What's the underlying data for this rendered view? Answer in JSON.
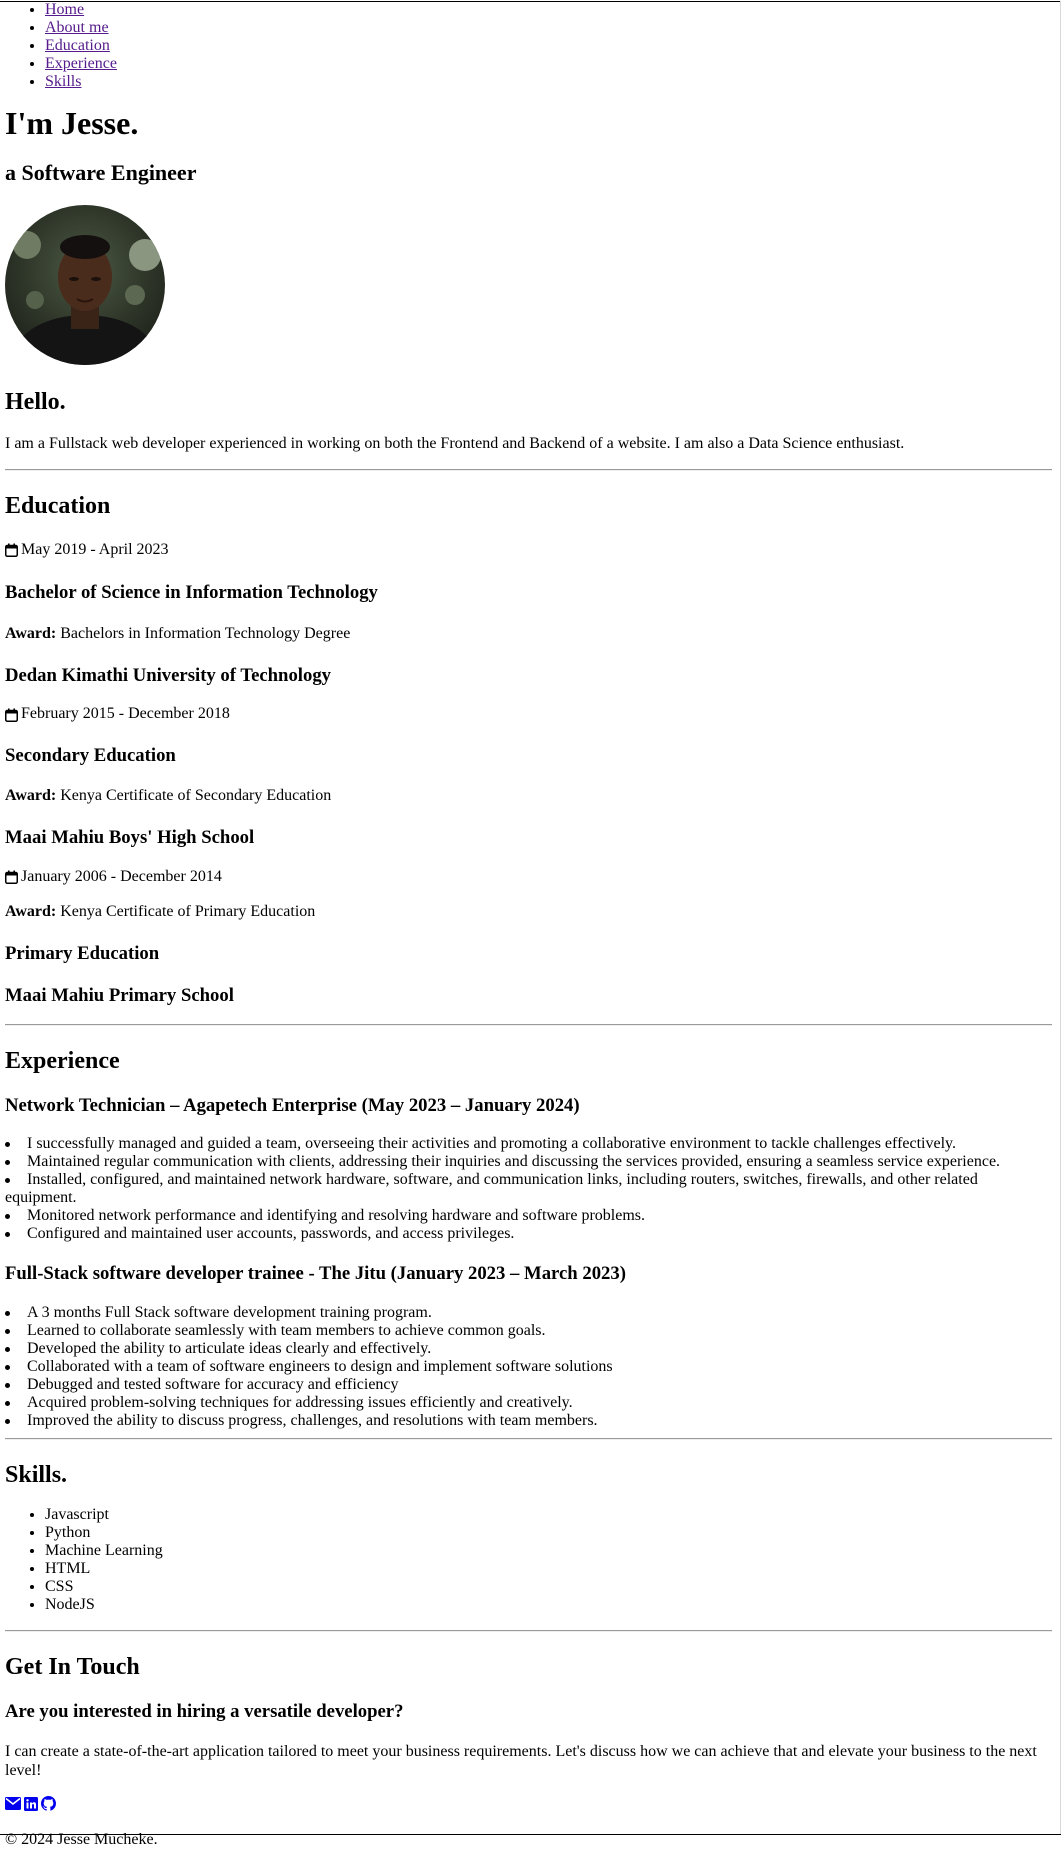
{
  "nav": {
    "items": [
      {
        "label": "Home"
      },
      {
        "label": "About me"
      },
      {
        "label": "Education"
      },
      {
        "label": "Experience"
      },
      {
        "label": "Skills"
      }
    ]
  },
  "hero": {
    "title": "I'm Jesse.",
    "subtitle": "a Software Engineer"
  },
  "about": {
    "heading": "Hello.",
    "text": "I am a Fullstack web developer experienced in working on both the Frontend and Backend of a website. I am also a Data Science enthusiast."
  },
  "education": {
    "heading": "Education",
    "award_label": "Award:",
    "date1": "May 2019 - April 2023",
    "degree1": "Bachelor of Science in Information Technology",
    "award1": "Bachelors in Information Technology Degree",
    "school1": "Dedan Kimathi University of Technology",
    "date2": "February 2015 - December 2018",
    "degree2": "Secondary Education",
    "award2": "Kenya Certificate of Secondary Education",
    "school2": "Maai Mahiu Boys' High School",
    "date3": "January 2006 - December 2014",
    "award3": "Kenya Certificate of Primary Education",
    "degree3": "Primary Education",
    "school3": "Maai Mahiu Primary School"
  },
  "experience": {
    "heading": "Experience",
    "job1": {
      "title": "Network Technician – Agapetech Enterprise (May 2023 – January 2024)",
      "bullets": [
        "I successfully managed and guided a team, overseeing their activities and promoting a collaborative environment to tackle challenges effectively.",
        "Maintained regular communication with clients, addressing their inquiries and discussing the services provided, ensuring a seamless service experience.",
        "Installed, configured, and maintained network hardware, software, and communication links, including routers, switches, firewalls, and other related equipment.",
        "Monitored network performance and identifying and resolving hardware and software problems.",
        "Configured and maintained user accounts, passwords, and access privileges."
      ]
    },
    "job2": {
      "title": "Full-Stack software developer trainee - The Jitu (January 2023 – March 2023)",
      "bullets": [
        "A 3 months Full Stack software development training program.",
        "Learned to collaborate seamlessly with team members to achieve common goals.",
        "Developed the ability to articulate ideas clearly and effectively.",
        "Collaborated with a team of software engineers to design and implement software solutions",
        "Debugged and tested software for accuracy and efficiency",
        "Acquired problem-solving techniques for addressing issues efficiently and creatively.",
        "Improved the ability to discuss progress, challenges, and resolutions with team members."
      ]
    }
  },
  "skills": {
    "heading": "Skills.",
    "items": [
      "Javascript",
      "Python",
      "Machine Learning",
      "HTML",
      "CSS",
      "NodeJS"
    ]
  },
  "contact": {
    "heading": "Get In Touch",
    "subheading": "Are you interested in hiring a versatile developer?",
    "text": "I can create a state-of-the-art application tailored to meet your business requirements. Let's discuss how we can achieve that and elevate your business to the next level!",
    "icons": [
      "envelope-icon",
      "linkedin-icon",
      "github-icon"
    ],
    "icon_color": "#0000ee"
  },
  "footer": {
    "copyright": "© 2024 Jesse Mucheke."
  }
}
